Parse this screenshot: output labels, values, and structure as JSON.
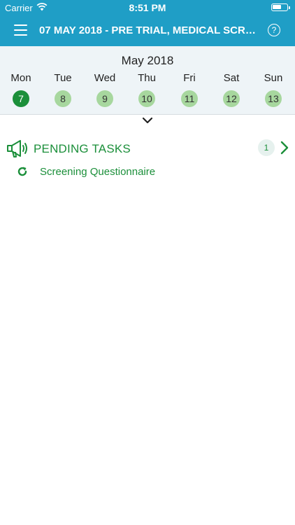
{
  "status_bar": {
    "carrier": "Carrier",
    "time": "8:51 PM"
  },
  "nav": {
    "title": "07 MAY 2018 - PRE TRIAL, MEDICAL SCRE...",
    "help_label": "?"
  },
  "calendar": {
    "month": "May 2018",
    "days": [
      {
        "name": "Mon",
        "num": "7",
        "selected": true
      },
      {
        "name": "Tue",
        "num": "8",
        "selected": false
      },
      {
        "name": "Wed",
        "num": "9",
        "selected": false
      },
      {
        "name": "Thu",
        "num": "10",
        "selected": false
      },
      {
        "name": "Fri",
        "num": "11",
        "selected": false
      },
      {
        "name": "Sat",
        "num": "12",
        "selected": false
      },
      {
        "name": "Sun",
        "num": "13",
        "selected": false
      }
    ]
  },
  "pending": {
    "title": "PENDING TASKS",
    "count": "1",
    "items": [
      {
        "label": "Screening Questionnaire"
      }
    ]
  },
  "colors": {
    "header": "#1f9ec6",
    "accent_green": "#1b8f3a",
    "day_circle": "#a7d79e",
    "calendar_bg": "#eef4f7"
  },
  "icons": [
    "menu-icon",
    "help-icon",
    "chevron-down-icon",
    "megaphone-icon",
    "chevron-right-icon",
    "refresh-icon",
    "wifi-icon",
    "battery-icon"
  ]
}
